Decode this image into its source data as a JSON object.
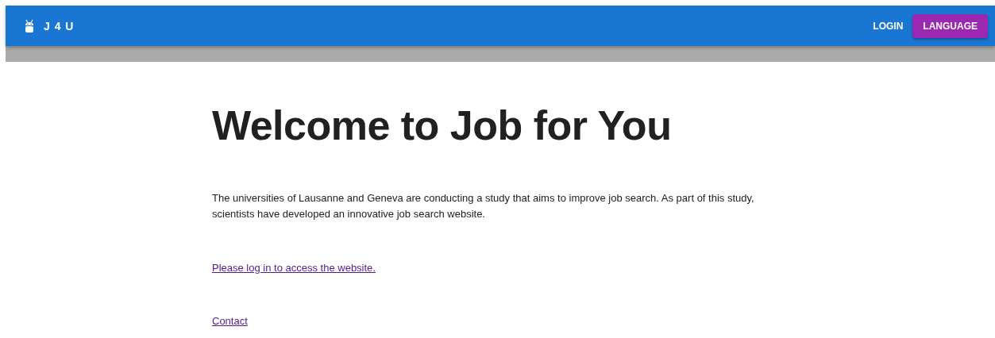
{
  "app_bar": {
    "logo_text": "J 4 U",
    "login": "LOGIN",
    "language": "LANGUAGE"
  },
  "title": "Welcome to Job for You",
  "intro": "The universities of Lausanne and Geneva are conducting a study that aims to improve job search. As part of this study, scientists have developed an innovative job search website.",
  "login_link": "Please log in to access the website.",
  "contact_link": "Contact"
}
